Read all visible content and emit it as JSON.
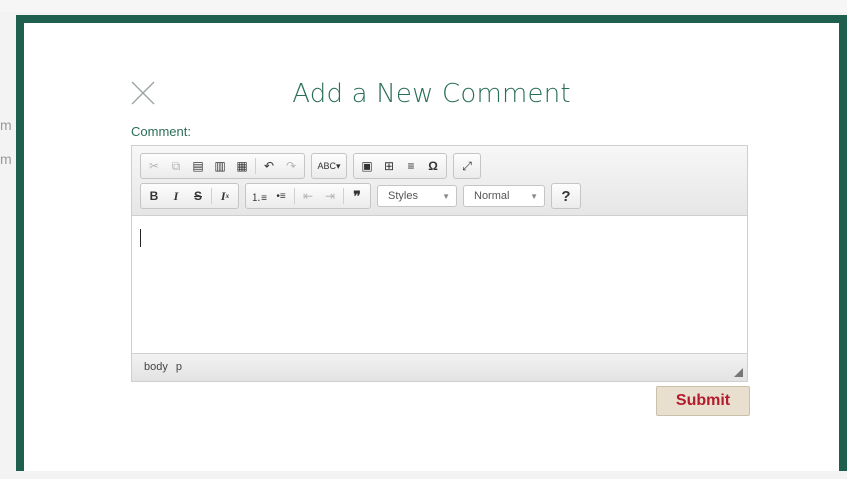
{
  "background": {
    "fragment1": "m",
    "fragment2": "m"
  },
  "modal": {
    "title": "Add a New Comment",
    "comment_label": "Comment:",
    "submit_label": "Submit",
    "border_color": "#1f5f4e",
    "accent_color": "#2b6e58"
  },
  "editor": {
    "toolbar_row1": [
      {
        "name": "cut-icon",
        "glyph": "✂",
        "enabled": false
      },
      {
        "name": "copy-icon",
        "glyph": "⧉",
        "enabled": false
      },
      {
        "name": "paste-icon",
        "glyph": "📋",
        "enabled": true
      },
      {
        "name": "paste-text-icon",
        "glyph": "📋",
        "enabled": true
      },
      {
        "name": "paste-word-icon",
        "glyph": "📋",
        "enabled": true
      },
      {
        "name": "undo-icon",
        "glyph": "↶",
        "enabled": true
      },
      {
        "name": "redo-icon",
        "glyph": "↷",
        "enabled": false
      },
      {
        "name": "spellcheck-icon",
        "glyph": "ABC",
        "enabled": true
      },
      {
        "name": "image-icon",
        "glyph": "▣",
        "enabled": true
      },
      {
        "name": "table-icon",
        "glyph": "⊞",
        "enabled": true
      },
      {
        "name": "horizontal-line-icon",
        "glyph": "≡",
        "enabled": true
      },
      {
        "name": "special-char-icon",
        "glyph": "Ω",
        "enabled": true
      },
      {
        "name": "maximize-icon",
        "glyph": "⤢",
        "enabled": true
      }
    ],
    "toolbar_row2": [
      {
        "name": "bold-icon",
        "glyph": "B"
      },
      {
        "name": "italic-icon",
        "glyph": "I"
      },
      {
        "name": "strike-icon",
        "glyph": "S"
      },
      {
        "name": "remove-format-icon",
        "glyph": "Ix"
      },
      {
        "name": "numbered-list-icon",
        "glyph": "1≡"
      },
      {
        "name": "bulleted-list-icon",
        "glyph": "•≡"
      },
      {
        "name": "outdent-icon",
        "glyph": "⇤"
      },
      {
        "name": "indent-icon",
        "glyph": "⇥"
      },
      {
        "name": "blockquote-icon",
        "glyph": "❞"
      }
    ],
    "styles_combo": "Styles",
    "format_combo": "Normal",
    "help_label": "?",
    "status_path": [
      "body",
      "p"
    ],
    "content_value": ""
  }
}
